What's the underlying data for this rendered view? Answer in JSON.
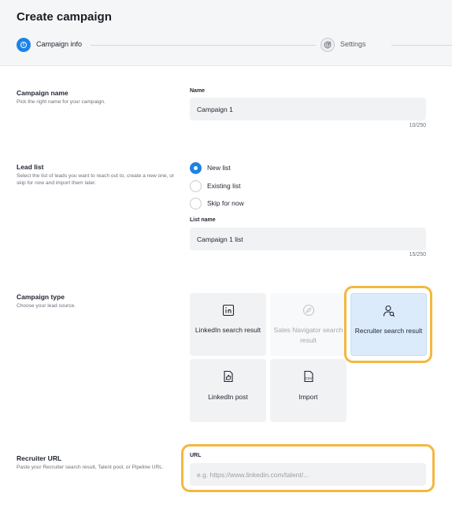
{
  "page": {
    "title": "Create campaign"
  },
  "stepper": {
    "steps": [
      {
        "label": "Campaign info",
        "active": true
      },
      {
        "label": "Settings",
        "active": false
      }
    ]
  },
  "campaign_name": {
    "title": "Campaign name",
    "description": "Pick the right name for your campaign.",
    "field_label": "Name",
    "value": "Campaign 1",
    "count": "10/250"
  },
  "lead_list": {
    "title": "Lead list",
    "description": "Select the list of leads you want to reach out to, create a new one, or skip for now and import them later.",
    "options": [
      {
        "label": "New list",
        "checked": true
      },
      {
        "label": "Existing list",
        "checked": false
      },
      {
        "label": "Skip for now",
        "checked": false
      }
    ],
    "field_label": "List name",
    "value": "Campaign 1 list",
    "count": "15/250"
  },
  "campaign_type": {
    "title": "Campaign type",
    "description": "Choose your lead source.",
    "cards": [
      {
        "label": "LinkedIn search result",
        "icon": "linkedin-icon",
        "state": "default"
      },
      {
        "label": "Sales Navigator search result",
        "icon": "compass-icon",
        "state": "disabled"
      },
      {
        "label": "Recruiter search result",
        "icon": "user-search-icon",
        "state": "selected"
      },
      {
        "label": "LinkedIn post",
        "icon": "thumbs-up-doc-icon",
        "state": "default"
      },
      {
        "label": "Import",
        "icon": "csv-file-icon",
        "state": "default"
      }
    ]
  },
  "recruiter_url": {
    "title": "Recruiter URL",
    "description": "Paste your Recruiter search result, Talent pool, or Pipeline URL.",
    "field_label": "URL",
    "placeholder": "e.g. https://www.linkedin.com/talent/..."
  },
  "colors": {
    "accent": "#1d83e6",
    "selected_card": "#dcebfb",
    "highlight": "#f4b73e",
    "input_bg": "#f1f2f3"
  }
}
